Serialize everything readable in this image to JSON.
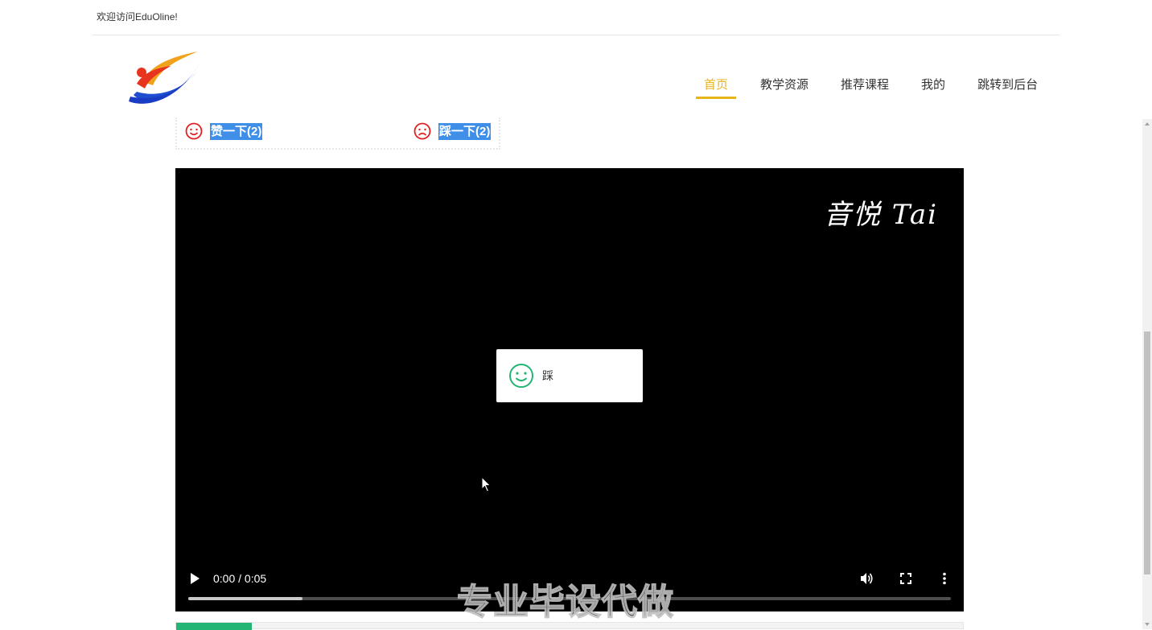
{
  "header": {
    "welcome": "欢迎访问EduOline!"
  },
  "nav": {
    "items": [
      {
        "label": "首页",
        "active": true
      },
      {
        "label": "教学资源",
        "active": false
      },
      {
        "label": "推荐课程",
        "active": false
      },
      {
        "label": "我的",
        "active": false
      },
      {
        "label": "跳转到后台",
        "active": false
      }
    ],
    "accent_color": "#e8b41c"
  },
  "votes": {
    "like_label": "赞一下(2)",
    "dislike_label": "踩一下(2)",
    "icon_color": "#e02020"
  },
  "video": {
    "watermark": "音悦 Tai",
    "time": "0:00 / 0:05",
    "progress": 0.15
  },
  "popup": {
    "text": "踩",
    "icon": "smiley-icon",
    "icon_color": "#22b573"
  },
  "overlay_watermark": "专业毕设代做"
}
